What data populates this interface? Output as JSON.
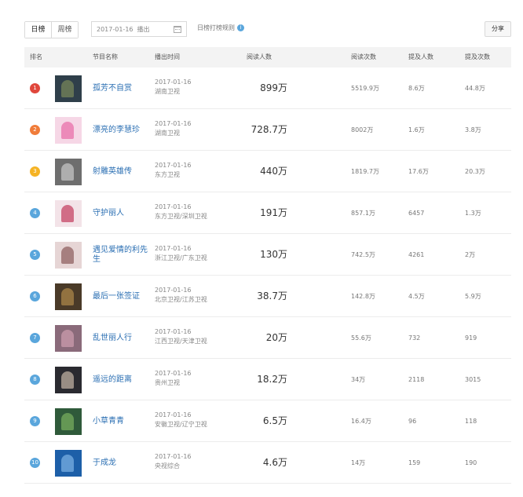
{
  "toolbar": {
    "tabs": [
      {
        "label": "日榜",
        "active": true
      },
      {
        "label": "周榜",
        "active": false
      }
    ],
    "date": "2017-01-16",
    "date_suffix": "播出",
    "rule_link": "日榜打榜规则",
    "share_label": "分享"
  },
  "table": {
    "headers": [
      "排名",
      "节目名称",
      "播出时间",
      "阅读人数",
      "阅读次数",
      "提及人数",
      "提及次数"
    ],
    "rows": [
      {
        "rank": "1",
        "name": "孤芳不自赏",
        "date": "2017-01-16",
        "channel": "湖南卫视",
        "readers": "899万",
        "reads": "5519.9万",
        "mentioners": "8.6万",
        "mentions": "44.8万",
        "badge_color": "#e0473c",
        "thumb": [
          "#2f3f4a",
          "#7a8a5a"
        ]
      },
      {
        "rank": "2",
        "name": "漂亮的李慧珍",
        "date": "2017-01-16",
        "channel": "湖南卫视",
        "readers": "728.7万",
        "reads": "8002万",
        "mentioners": "1.6万",
        "mentions": "3.8万",
        "badge_color": "#f07c3a",
        "thumb": [
          "#f6d7e6",
          "#e86aa5"
        ]
      },
      {
        "rank": "3",
        "name": "射雕英雄传",
        "date": "2017-01-16",
        "channel": "东方卫视",
        "readers": "440万",
        "reads": "1819.7万",
        "mentioners": "17.6万",
        "mentions": "20.3万",
        "badge_color": "#f5b324",
        "thumb": [
          "#6e6e6e",
          "#c9c9c9"
        ]
      },
      {
        "rank": "4",
        "name": "守护丽人",
        "date": "2017-01-16",
        "channel": "东方卫视/深圳卫视",
        "readers": "191万",
        "reads": "857.1万",
        "mentioners": "6457",
        "mentions": "1.3万",
        "badge_color": "#5aa6dc",
        "thumb": [
          "#f3e3e8",
          "#c23a5c"
        ]
      },
      {
        "rank": "5",
        "name": "遇见爱情的利先生",
        "date": "2017-01-16",
        "channel": "浙江卫视/广东卫视",
        "readers": "130万",
        "reads": "742.5万",
        "mentioners": "4261",
        "mentions": "2万",
        "badge_color": "#5aa6dc",
        "thumb": [
          "#e6d5d5",
          "#8a5a5a"
        ]
      },
      {
        "rank": "6",
        "name": "最后一张签证",
        "date": "2017-01-16",
        "channel": "北京卫视/江苏卫视",
        "readers": "38.7万",
        "reads": "142.8万",
        "mentioners": "4.5万",
        "mentions": "5.9万",
        "badge_color": "#5aa6dc",
        "thumb": [
          "#4a3a28",
          "#b08a4a"
        ]
      },
      {
        "rank": "7",
        "name": "乱世丽人行",
        "date": "2017-01-16",
        "channel": "江西卫视/天津卫视",
        "readers": "20万",
        "reads": "55.6万",
        "mentioners": "732",
        "mentions": "919",
        "badge_color": "#5aa6dc",
        "thumb": [
          "#8a6a7a",
          "#d0a0b0"
        ]
      },
      {
        "rank": "8",
        "name": "遥远的距离",
        "date": "2017-01-16",
        "channel": "贵州卫视",
        "readers": "18.2万",
        "reads": "34万",
        "mentioners": "2118",
        "mentions": "3015",
        "badge_color": "#5aa6dc",
        "thumb": [
          "#2a2a30",
          "#c8b8a8"
        ]
      },
      {
        "rank": "9",
        "name": "小草青青",
        "date": "2017-01-16",
        "channel": "安徽卫视/辽宁卫视",
        "readers": "6.5万",
        "reads": "16.4万",
        "mentioners": "96",
        "mentions": "118",
        "badge_color": "#5aa6dc",
        "thumb": [
          "#2f5a3a",
          "#7ab060"
        ]
      },
      {
        "rank": "10",
        "name": "于成龙",
        "date": "2017-01-16",
        "channel": "央视综合",
        "readers": "4.6万",
        "reads": "14万",
        "mentioners": "159",
        "mentions": "190",
        "badge_color": "#5aa6dc",
        "thumb": [
          "#1d5fa8",
          "#7fb4e6"
        ]
      }
    ]
  }
}
